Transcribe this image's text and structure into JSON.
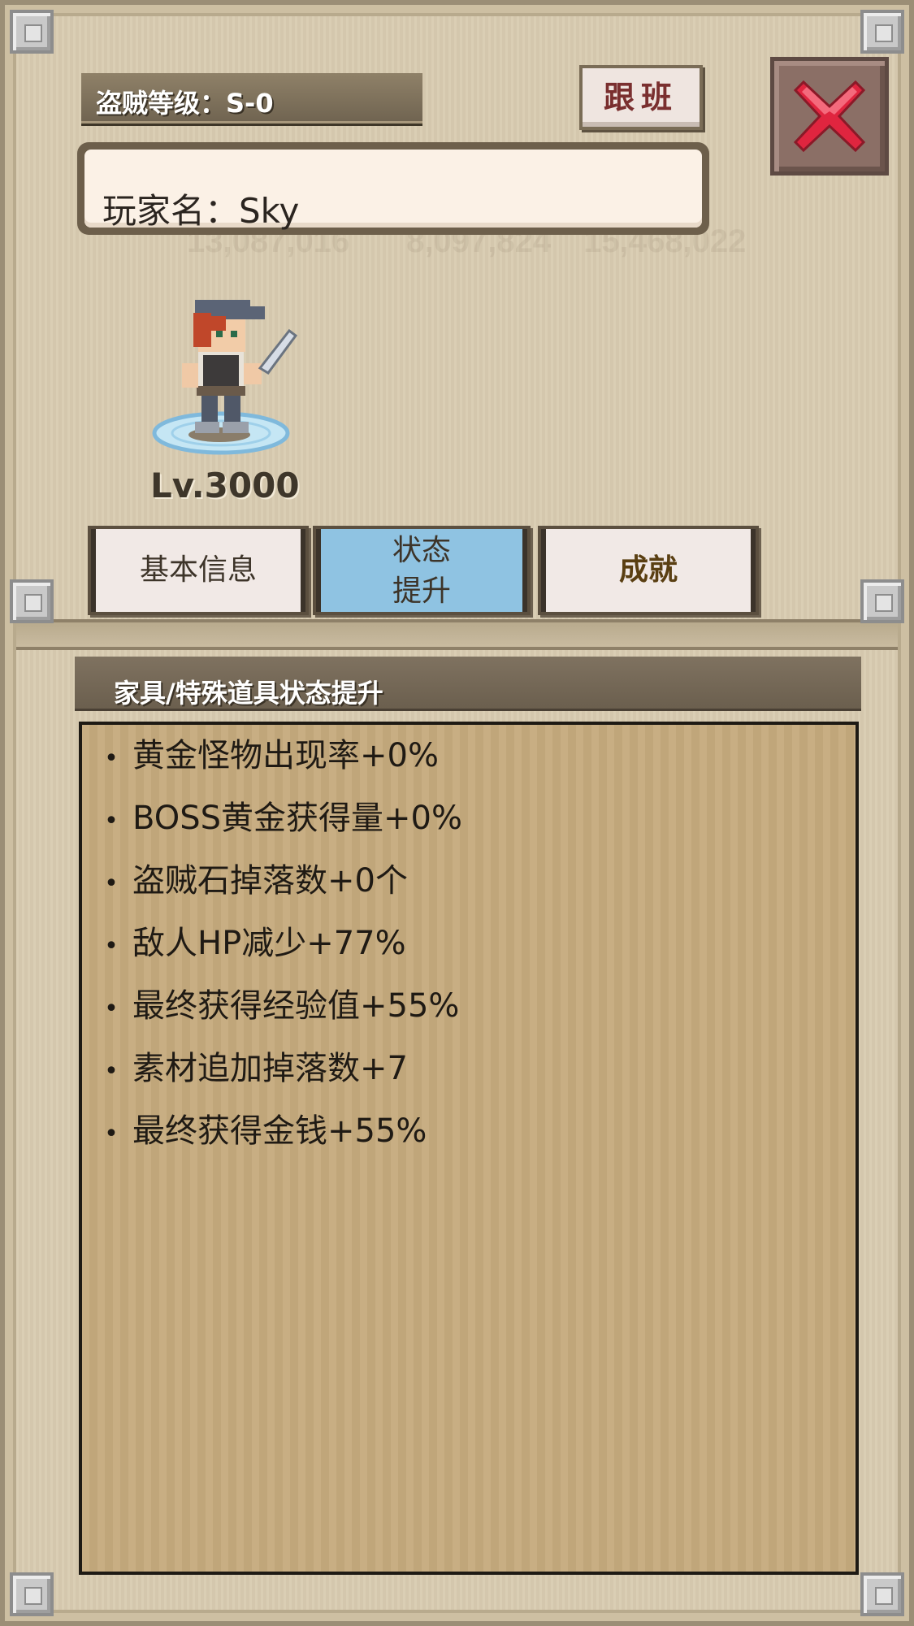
{
  "header": {
    "rank_label": "盗贼等级：S-0",
    "follow_button": "跟班",
    "close_icon": "close-x-icon"
  },
  "player": {
    "name_label": "玩家名：Sky",
    "level": "Lv.3000",
    "avatar_icon": "thief-character-sprite"
  },
  "tabs": [
    {
      "label": "基本信息",
      "active": false
    },
    {
      "label": "状态\n提升",
      "label_line1": "状态",
      "label_line2": "提升",
      "active": true
    },
    {
      "label": "成就",
      "active": false
    }
  ],
  "section": {
    "title": "家具/特殊道具状态提升"
  },
  "stats": [
    "黄金怪物出现率+0%",
    "BOSS黄金获得量+0%",
    "盗贼石掉落数+0个",
    "敌人HP减少+77%",
    "最终获得经验值+55%",
    "素材追加掉落数+7",
    "最终获得金钱+55%"
  ],
  "colors": {
    "active_tab": "#8fc3e2",
    "panel_bg": "#c6ab7e",
    "close_x": "#e0253f"
  }
}
